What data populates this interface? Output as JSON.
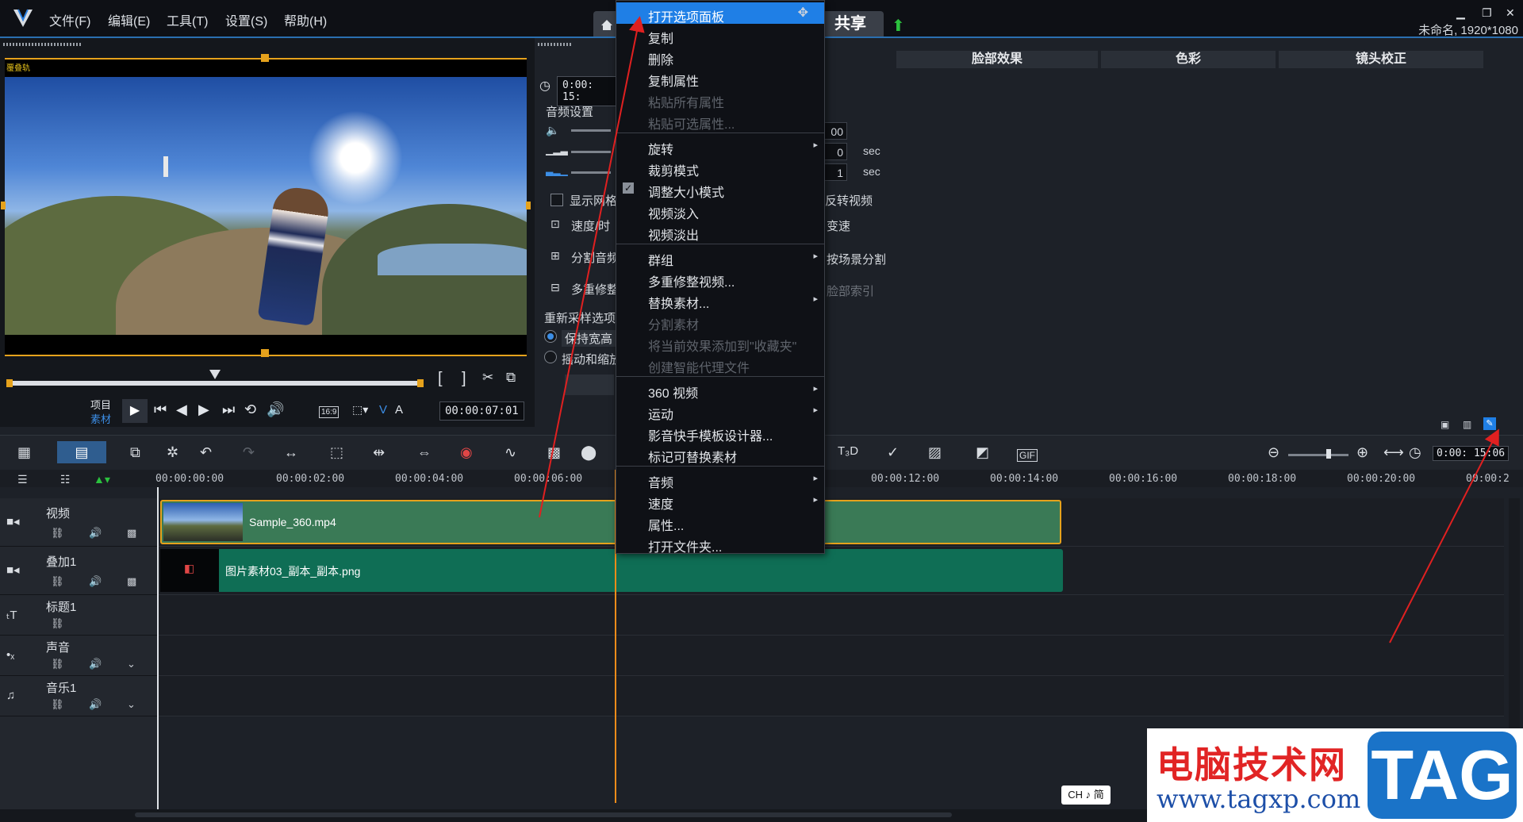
{
  "app": {
    "menus": [
      "文件(F)",
      "编辑(E)",
      "工具(T)",
      "设置(S)",
      "帮助(H)"
    ],
    "share_tab": "共享",
    "project_info": "未命名, 1920*1080"
  },
  "player": {
    "mode_project": "项目",
    "mode_clip": "素材",
    "aspect": "16:9",
    "timecode": "00:00:07:01",
    "overlay_label": "覆叠轨"
  },
  "options": {
    "time_value": "0:00: 15:",
    "tabs": [
      "脸部效果",
      "色彩",
      "镜头校正"
    ],
    "audio_settings": "音频设置",
    "spin_values": [
      "00",
      "0",
      "1"
    ],
    "sec": "sec",
    "show_grid": "显示网格",
    "speed_time": "速度/时",
    "split_audio": "分割音频",
    "multi_trim": "多重修整",
    "resample": "重新采样选项",
    "keep_aspect": "保持宽高",
    "pan_zoom": "摇动和缩放",
    "reverse_video": "反转视频",
    "speed_change": "变速",
    "scene_split": "按场景分割",
    "face_index": "脸部索引"
  },
  "context_menu": {
    "items": [
      {
        "label": "打开选项面板",
        "state": "highlight"
      },
      {
        "label": "复制",
        "state": "normal"
      },
      {
        "label": "删除",
        "state": "normal"
      },
      {
        "label": "复制属性",
        "state": "normal"
      },
      {
        "label": "粘贴所有属性",
        "state": "disabled"
      },
      {
        "label": "粘贴可选属性...",
        "state": "disabled"
      },
      {
        "label": "旋转",
        "state": "normal",
        "submenu": true
      },
      {
        "label": "裁剪模式",
        "state": "normal"
      },
      {
        "label": "调整大小模式",
        "state": "normal",
        "checked": true
      },
      {
        "label": "视频淡入",
        "state": "normal"
      },
      {
        "label": "视频淡出",
        "state": "normal"
      },
      {
        "label": "群组",
        "state": "normal",
        "submenu": true
      },
      {
        "label": "多重修整视频...",
        "state": "normal"
      },
      {
        "label": "替换素材...",
        "state": "normal",
        "submenu": true
      },
      {
        "label": "分割素材",
        "state": "disabled"
      },
      {
        "label": "将当前效果添加到\"收藏夹\"",
        "state": "disabled"
      },
      {
        "label": "创建智能代理文件",
        "state": "disabled"
      },
      {
        "label": "360 视频",
        "state": "normal",
        "submenu": true
      },
      {
        "label": "运动",
        "state": "normal",
        "submenu": true
      },
      {
        "label": "影音快手模板设计器...",
        "state": "normal"
      },
      {
        "label": "标记可替换素材",
        "state": "normal"
      },
      {
        "label": "音频",
        "state": "normal",
        "submenu": true
      },
      {
        "label": "速度",
        "state": "normal",
        "submenu": true
      },
      {
        "label": "属性...",
        "state": "normal"
      },
      {
        "label": "打开文件夹...",
        "state": "normal"
      }
    ]
  },
  "timeline": {
    "zoom_time": "0:00: 15:06",
    "ruler": [
      "00:00:00:00",
      "00:00:02:00",
      "00:00:04:00",
      "00:00:06:00",
      "00:00:12:00",
      "00:00:14:00",
      "00:00:16:00",
      "00:00:18:00",
      "00:00:20:00",
      "00:00:2"
    ],
    "tracks": [
      "视频",
      "叠加1",
      "标题1",
      "声音",
      "音乐1"
    ],
    "clips": {
      "video": "Sample_360.mp4",
      "overlay": "图片素材03_副本_副本.png"
    }
  },
  "watermark": {
    "cn": "电脑技术网",
    "url": "www.tagxp.com",
    "tag": "TAG"
  },
  "ime": "CH ♪ 简",
  "colors": {
    "accent": "#1f7fe6",
    "clip_video": "#3a7a56",
    "clip_overlay": "#0f6e55",
    "trim_handle": "#e6a21c",
    "playhead": "#f08c1a",
    "annotation_arrow": "#e02020"
  }
}
